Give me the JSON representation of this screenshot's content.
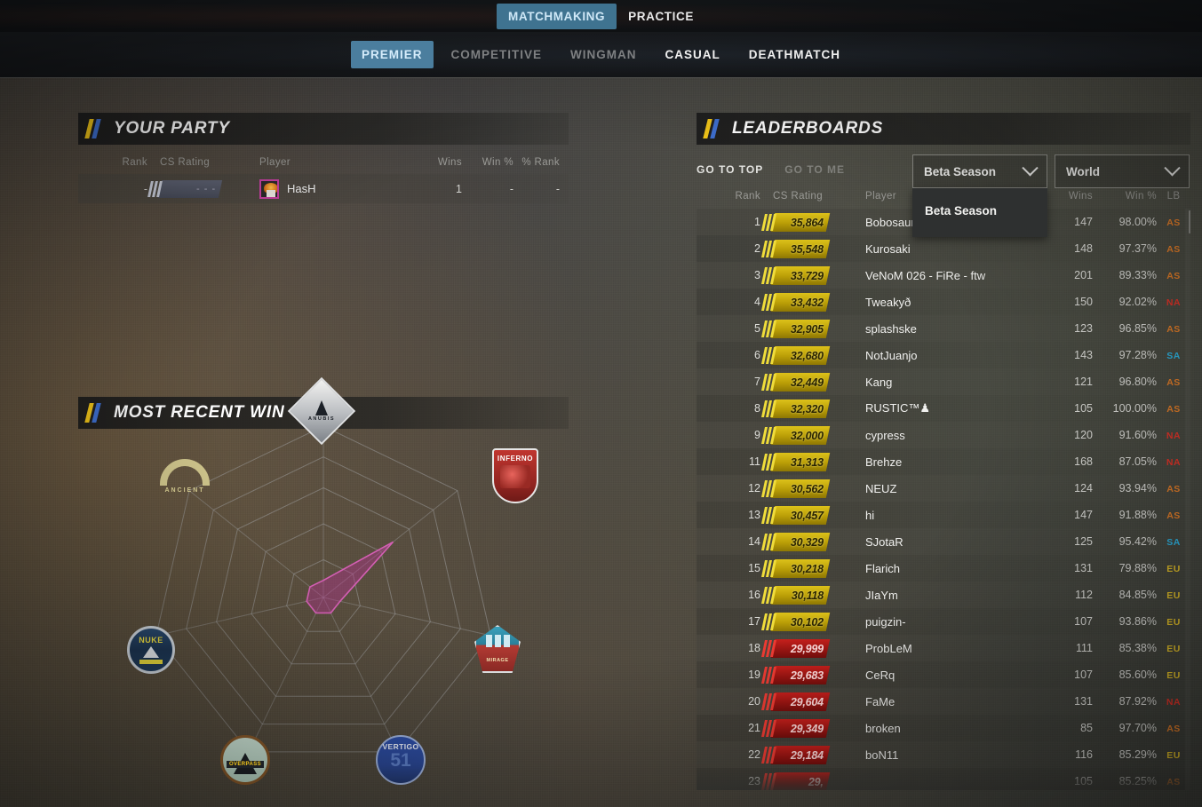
{
  "topnav": {
    "tabs": [
      {
        "label": "MATCHMAKING",
        "active": true
      },
      {
        "label": "PRACTICE",
        "active": false
      }
    ]
  },
  "subnav": {
    "tabs": [
      {
        "label": "PREMIER",
        "state": "active"
      },
      {
        "label": "COMPETITIVE",
        "state": "dim"
      },
      {
        "label": "WINGMAN",
        "state": "dim"
      },
      {
        "label": "CASUAL",
        "state": "bright"
      },
      {
        "label": "DEATHMATCH",
        "state": "bright"
      }
    ]
  },
  "party": {
    "title": "YOUR PARTY",
    "columns": [
      "Rank",
      "CS Rating",
      "Player",
      "Wins",
      "Win %",
      "% Rank"
    ],
    "rows": [
      {
        "rank": "-",
        "rating": "- - -",
        "player": "HasH",
        "wins": "1",
        "win_pct": "-",
        "pct_rank": "-"
      }
    ]
  },
  "recent_win": {
    "title": "MOST RECENT WIN",
    "maps": [
      {
        "name": "ANUBIS",
        "icon": "anubis-map-icon"
      },
      {
        "name": "INFERNO",
        "icon": "inferno-map-icon"
      },
      {
        "name": "MIRAGE",
        "icon": "mirage-map-icon"
      },
      {
        "name": "VERTIGO",
        "icon": "vertigo-map-icon"
      },
      {
        "name": "OVERPASS",
        "icon": "overpass-map-icon"
      },
      {
        "name": "NUKE",
        "icon": "nuke-map-icon"
      },
      {
        "name": "ANCIENT",
        "icon": "ancient-map-icon"
      }
    ],
    "accent_color": "#b5338f"
  },
  "leaderboards": {
    "title": "LEADERBOARDS",
    "go_to_top": "GO TO TOP",
    "go_to_me": "GO TO ME",
    "season_dropdown": {
      "value": "Beta Season",
      "open": true,
      "options": [
        "Beta Season"
      ]
    },
    "region_dropdown": {
      "value": "World",
      "open": false
    },
    "columns": [
      "Rank",
      "CS Rating",
      "Player",
      "Wins",
      "Win %",
      "LB"
    ],
    "rows": [
      {
        "rank": "1",
        "rating": "35,864",
        "tier": "gold",
        "player": "Bobosaur",
        "wins": "147",
        "win_pct": "98.00%",
        "lb": "AS"
      },
      {
        "rank": "2",
        "rating": "35,548",
        "tier": "gold",
        "player": "Kurosaki",
        "wins": "148",
        "win_pct": "97.37%",
        "lb": "AS"
      },
      {
        "rank": "3",
        "rating": "33,729",
        "tier": "gold",
        "player": "VeNoM 026 - FiRe - ftw",
        "wins": "201",
        "win_pct": "89.33%",
        "lb": "AS"
      },
      {
        "rank": "4",
        "rating": "33,432",
        "tier": "gold",
        "player": "Tweakyð",
        "wins": "150",
        "win_pct": "92.02%",
        "lb": "NA"
      },
      {
        "rank": "5",
        "rating": "32,905",
        "tier": "gold",
        "player": "splashske",
        "wins": "123",
        "win_pct": "96.85%",
        "lb": "AS"
      },
      {
        "rank": "6",
        "rating": "32,680",
        "tier": "gold",
        "player": "NotJuanjo",
        "wins": "143",
        "win_pct": "97.28%",
        "lb": "SA"
      },
      {
        "rank": "7",
        "rating": "32,449",
        "tier": "gold",
        "player": "Kang",
        "wins": "121",
        "win_pct": "96.80%",
        "lb": "AS"
      },
      {
        "rank": "8",
        "rating": "32,320",
        "tier": "gold",
        "player": "RUSTIC™♟",
        "wins": "105",
        "win_pct": "100.00%",
        "lb": "AS"
      },
      {
        "rank": "9",
        "rating": "32,000",
        "tier": "gold",
        "player": "cypress",
        "wins": "120",
        "win_pct": "91.60%",
        "lb": "NA"
      },
      {
        "rank": "11",
        "rating": "31,313",
        "tier": "gold",
        "player": "Brehze",
        "wins": "168",
        "win_pct": "87.05%",
        "lb": "NA"
      },
      {
        "rank": "12",
        "rating": "30,562",
        "tier": "gold",
        "player": "NEUZ",
        "wins": "124",
        "win_pct": "93.94%",
        "lb": "AS"
      },
      {
        "rank": "13",
        "rating": "30,457",
        "tier": "gold",
        "player": "hi",
        "wins": "147",
        "win_pct": "91.88%",
        "lb": "AS"
      },
      {
        "rank": "14",
        "rating": "30,329",
        "tier": "gold",
        "player": "SJotaR",
        "wins": "125",
        "win_pct": "95.42%",
        "lb": "SA"
      },
      {
        "rank": "15",
        "rating": "30,218",
        "tier": "gold",
        "player": "Flarich",
        "wins": "131",
        "win_pct": "79.88%",
        "lb": "EU"
      },
      {
        "rank": "16",
        "rating": "30,118",
        "tier": "gold",
        "player": "JIaYm",
        "wins": "112",
        "win_pct": "84.85%",
        "lb": "EU"
      },
      {
        "rank": "17",
        "rating": "30,102",
        "tier": "gold",
        "player": "puigzin-",
        "wins": "107",
        "win_pct": "93.86%",
        "lb": "EU"
      },
      {
        "rank": "18",
        "rating": "29,999",
        "tier": "red",
        "player": "ProbLeM",
        "wins": "111",
        "win_pct": "85.38%",
        "lb": "EU"
      },
      {
        "rank": "19",
        "rating": "29,683",
        "tier": "red",
        "player": "CeRq",
        "wins": "107",
        "win_pct": "85.60%",
        "lb": "EU"
      },
      {
        "rank": "20",
        "rating": "29,604",
        "tier": "red",
        "player": "FaMe",
        "wins": "131",
        "win_pct": "87.92%",
        "lb": "NA"
      },
      {
        "rank": "21",
        "rating": "29,349",
        "tier": "red",
        "player": "broken",
        "wins": "85",
        "win_pct": "97.70%",
        "lb": "AS"
      },
      {
        "rank": "22",
        "rating": "29,184",
        "tier": "red",
        "player": "boN11",
        "wins": "116",
        "win_pct": "85.29%",
        "lb": "EU"
      },
      {
        "rank": "23",
        "rating": "29,",
        "tier": "red",
        "player": "",
        "wins": "105",
        "win_pct": "85.25%",
        "lb": "AS"
      }
    ]
  }
}
